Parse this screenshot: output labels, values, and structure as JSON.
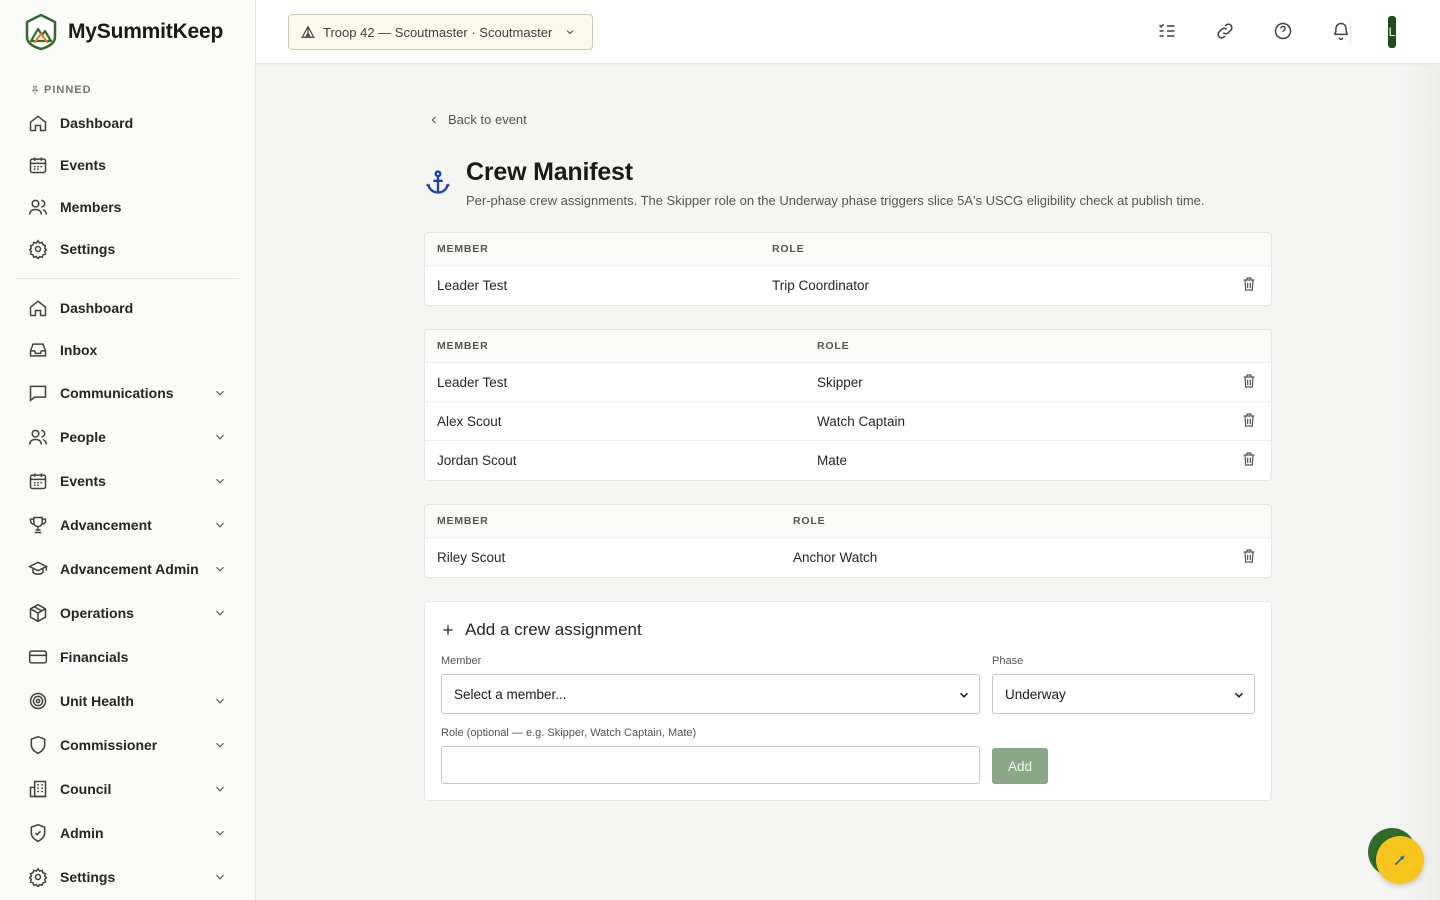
{
  "app": {
    "name": "MySummitKeep"
  },
  "sidebar": {
    "pinned_label": "PINNED",
    "pinned": [
      {
        "label": "Dashboard",
        "icon": "home-icon"
      },
      {
        "label": "Events",
        "icon": "calendar-icon"
      },
      {
        "label": "Members",
        "icon": "users-icon"
      },
      {
        "label": "Settings",
        "icon": "gear-icon"
      }
    ],
    "items": [
      {
        "label": "Dashboard",
        "icon": "home-icon",
        "expandable": false
      },
      {
        "label": "Inbox",
        "icon": "inbox-icon",
        "expandable": false
      },
      {
        "label": "Communications",
        "icon": "message-icon",
        "expandable": true
      },
      {
        "label": "People",
        "icon": "users-icon",
        "expandable": true
      },
      {
        "label": "Events",
        "icon": "calendar-icon",
        "expandable": true
      },
      {
        "label": "Advancement",
        "icon": "trophy-icon",
        "expandable": true
      },
      {
        "label": "Advancement Admin",
        "icon": "graduation-cap-icon",
        "expandable": true
      },
      {
        "label": "Operations",
        "icon": "box-icon",
        "expandable": true
      },
      {
        "label": "Financials",
        "icon": "credit-card-icon",
        "expandable": false
      },
      {
        "label": "Unit Health",
        "icon": "target-icon",
        "expandable": true
      },
      {
        "label": "Commissioner",
        "icon": "shield-icon",
        "expandable": true
      },
      {
        "label": "Council",
        "icon": "building-icon",
        "expandable": true
      },
      {
        "label": "Admin",
        "icon": "shield-check-icon",
        "expandable": true
      },
      {
        "label": "Settings",
        "icon": "gear-icon",
        "expandable": true
      }
    ]
  },
  "topbar": {
    "unit_selector": "Troop 42 — Scoutmaster · Scoutmaster",
    "avatar_initial": "L"
  },
  "page": {
    "back_label": "Back to event",
    "title": "Crew Manifest",
    "subtitle": "Per-phase crew assignments. The Skipper role on the Underway phase triggers slice 5A's USCG eligibility check at publish time."
  },
  "tables": [
    {
      "col_member": "MEMBER",
      "col_role": "ROLE",
      "rows": [
        {
          "member": "Leader Test",
          "role": "Trip Coordinator"
        }
      ]
    },
    {
      "col_member": "MEMBER",
      "col_role": "ROLE",
      "rows": [
        {
          "member": "Leader Test",
          "role": "Skipper"
        },
        {
          "member": "Alex Scout",
          "role": "Watch Captain"
        },
        {
          "member": "Jordan Scout",
          "role": "Mate"
        }
      ]
    },
    {
      "col_member": "MEMBER",
      "col_role": "ROLE",
      "rows": [
        {
          "member": "Riley Scout",
          "role": "Anchor Watch"
        }
      ]
    }
  ],
  "add_form": {
    "title": "Add a crew assignment",
    "member_label": "Member",
    "member_value": "Select a member...",
    "phase_label": "Phase",
    "phase_value": "Underway",
    "role_label": "Role (optional — e.g. Skipper, Watch Captain, Mate)",
    "role_value": "",
    "add_label": "Add"
  },
  "colors": {
    "accent_green": "#2f6b2b",
    "fab_yellow": "#f7c51d",
    "anchor_blue": "#1e40af",
    "add_button": "#8aa888"
  }
}
